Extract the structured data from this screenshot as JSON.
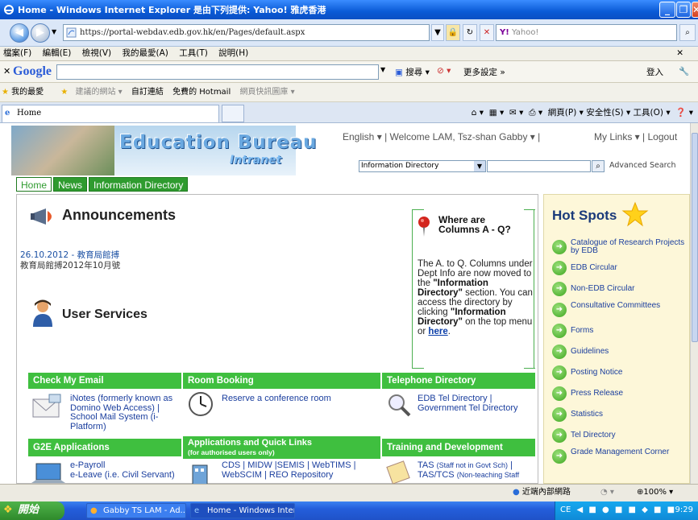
{
  "window": {
    "title": "Home - Windows Internet Explorer 是由下列提供: Yahoo! 雅虎香港"
  },
  "address": {
    "url": "https://portal-webdav.edb.gov.hk/en/Pages/default.aspx",
    "search_placeholder": "Yahoo!"
  },
  "menu": [
    "檔案(F)",
    "編輯(E)",
    "檢視(V)",
    "我的最愛(A)",
    "工具(T)",
    "說明(H)"
  ],
  "google_bar": {
    "logo": "Google",
    "search_label": "搜尋",
    "settings": "更多設定 »",
    "login": "登入"
  },
  "favorites": {
    "label": "我的最愛",
    "items": [
      "建議的網站 ▾",
      "自訂連結",
      "免費的 Hotmail",
      "網頁快訊圖庫 ▾"
    ]
  },
  "tab": {
    "title": "Home",
    "tools": "網頁(P) ▾  安全性(S) ▾  工具(O) ▾"
  },
  "site": {
    "title": "Education Bureau",
    "subtitle": "Intranet",
    "lang": "English ▾",
    "welcome": "| Welcome LAM, Tsz-shan Gabby ▾ |",
    "mylinks": "My Links ▾  | Logout",
    "search_select": "Information Directory",
    "adv_search": "Advanced Search",
    "nav": [
      "Home",
      "News",
      "Information Directory"
    ]
  },
  "announcements": {
    "title": "Announcements",
    "date": "26.10.2012 - 教育局館搏",
    "subtitle": "教育局館搏2012年10月號"
  },
  "user_services": {
    "title": "User Services"
  },
  "columns_box": {
    "title_line1": "Where are",
    "title_line2": "Columns A - Q?",
    "text1": "The A. to Q. Columns under Dept Info are now moved to the ",
    "bold1": "\"Information Directory\"",
    "text2": " section. You can access the directory by clicking ",
    "bold2": "\"Information Directory\"",
    "text3": " on the top menu or ",
    "link": "here",
    "text4": "."
  },
  "sections": {
    "email": {
      "header": "Check My Email",
      "item": "iNotes (formerly known as Domino Web Access) | School Mail System (i-Platform)"
    },
    "room": {
      "header": "Room Booking",
      "item": "Reserve a conference room"
    },
    "tel": {
      "header": "Telephone Directory",
      "item": "EDB Tel Directory | Government Tel Directory"
    },
    "g2e": {
      "header": "G2E Applications",
      "item1": "e-Payroll",
      "item2": "e-Leave (i.e. Civil Servant)"
    },
    "apps": {
      "header": "Applications and Quick Links",
      "sub": "(for authorised users only)",
      "item": "CDS | MIDW |SEMIS | WebTIMS | WebSCIM | REO Repository"
    },
    "training": {
      "header": "Training and Development",
      "item1": "TAS ",
      "item1s": "(Staff not in Govt Sch)",
      "item1b": " |",
      "item2": "TAS/TCS ",
      "item2s": "(Non-teaching Staff"
    }
  },
  "hotspots": {
    "title": "Hot Spots",
    "items": [
      "Catalogue of Research Projects by EDB",
      "EDB Circular",
      "Non-EDB Circular",
      "Consultative Committees",
      "Forms",
      "Guidelines",
      "Posting Notice",
      "Press Release",
      "Statistics",
      "Tel Directory",
      "Grade Management Corner"
    ]
  },
  "status": {
    "zone": "近端內部網路",
    "zoom": "100%"
  },
  "taskbar": {
    "start": "開始",
    "items": [
      "Gabby TS LAM - Ad...",
      "Home - Windows Inter..."
    ],
    "lang": "CE",
    "time": "9:29"
  }
}
